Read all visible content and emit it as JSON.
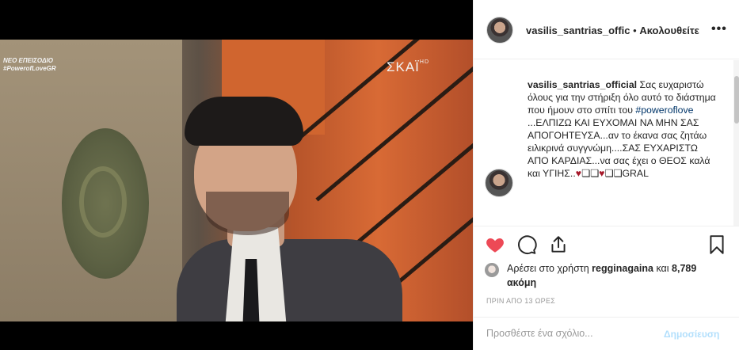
{
  "video": {
    "overlay_top_line1": "ΝΕΟ ΕΠΕΙΣΟΔΙΟ",
    "overlay_top_line2": "#PowerofLoveGR",
    "logo": "ΣΚΑΪ",
    "logo_hd": "HD"
  },
  "header": {
    "username": "vasilis_santrias_offic",
    "separator": "•",
    "follow_label": "Ακολουθείτε",
    "more_label": "•••"
  },
  "caption": {
    "username": "vasilis_santrias_official",
    "text1": " Σας ευχαριστώ όλους για την στήριξη όλο αυτό το διάστημα που ήμουν στο σπίτι του ",
    "hashtag": "#powerofl​ove",
    "text2": " ...ΕΛΠΙΖΩ ΚΑΙ ΕΥΧΟΜΑΙ ΝΑ ΜΗΝ ΣΑΣ ΑΠΟΓΟΗΤΕΥΣΑ...αν το έκανα σας ζητάω ειλικρινά συγγνώμη....ΣΑΣ ΕΥΧΑΡΙΣΤΩ ΑΠΟ ΚΑΡΔΙΑΣ...να σας έχει ο ΘΕΟΣ καλά και ΥΓΙΗΣ..",
    "emoji1": "♥",
    "text3": "❏❏",
    "emoji2": "♥",
    "text4": "❏❏GRAL"
  },
  "likes": {
    "prefix": "Αρέσει στο χρήστη ",
    "user": "regginagaina",
    "middle": " και ",
    "count": "8,789 ακόμη"
  },
  "timestamp": "ΠΡΙΝ ΑΠΟ 13 ΩΡΕΣ",
  "comment": {
    "placeholder": "Προσθέστε ένα σχόλιο...",
    "post_label": "Δημοσίευση"
  },
  "colors": {
    "like_red": "#ed4956",
    "link": "#003569",
    "post_disabled": "#b2dffc"
  }
}
